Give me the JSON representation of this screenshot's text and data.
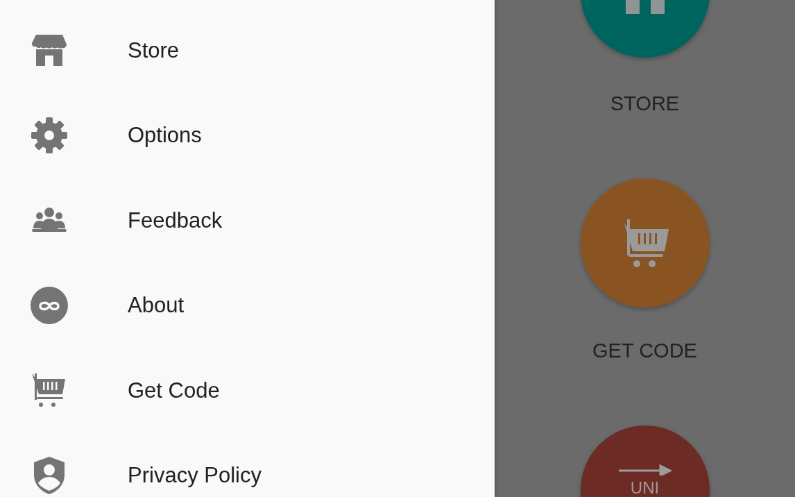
{
  "drawer": {
    "items": [
      {
        "label": "Store"
      },
      {
        "label": "Options"
      },
      {
        "label": "Feedback"
      },
      {
        "label": "About"
      },
      {
        "label": "Get Code"
      },
      {
        "label": "Privacy Policy"
      }
    ]
  },
  "screen": {
    "tiles": [
      {
        "color": "#00645e",
        "label": "STORE"
      },
      {
        "color": "#8a5422",
        "label": "GET CODE"
      },
      {
        "color": "#6c2b24",
        "badge_text": "UNI"
      }
    ]
  }
}
